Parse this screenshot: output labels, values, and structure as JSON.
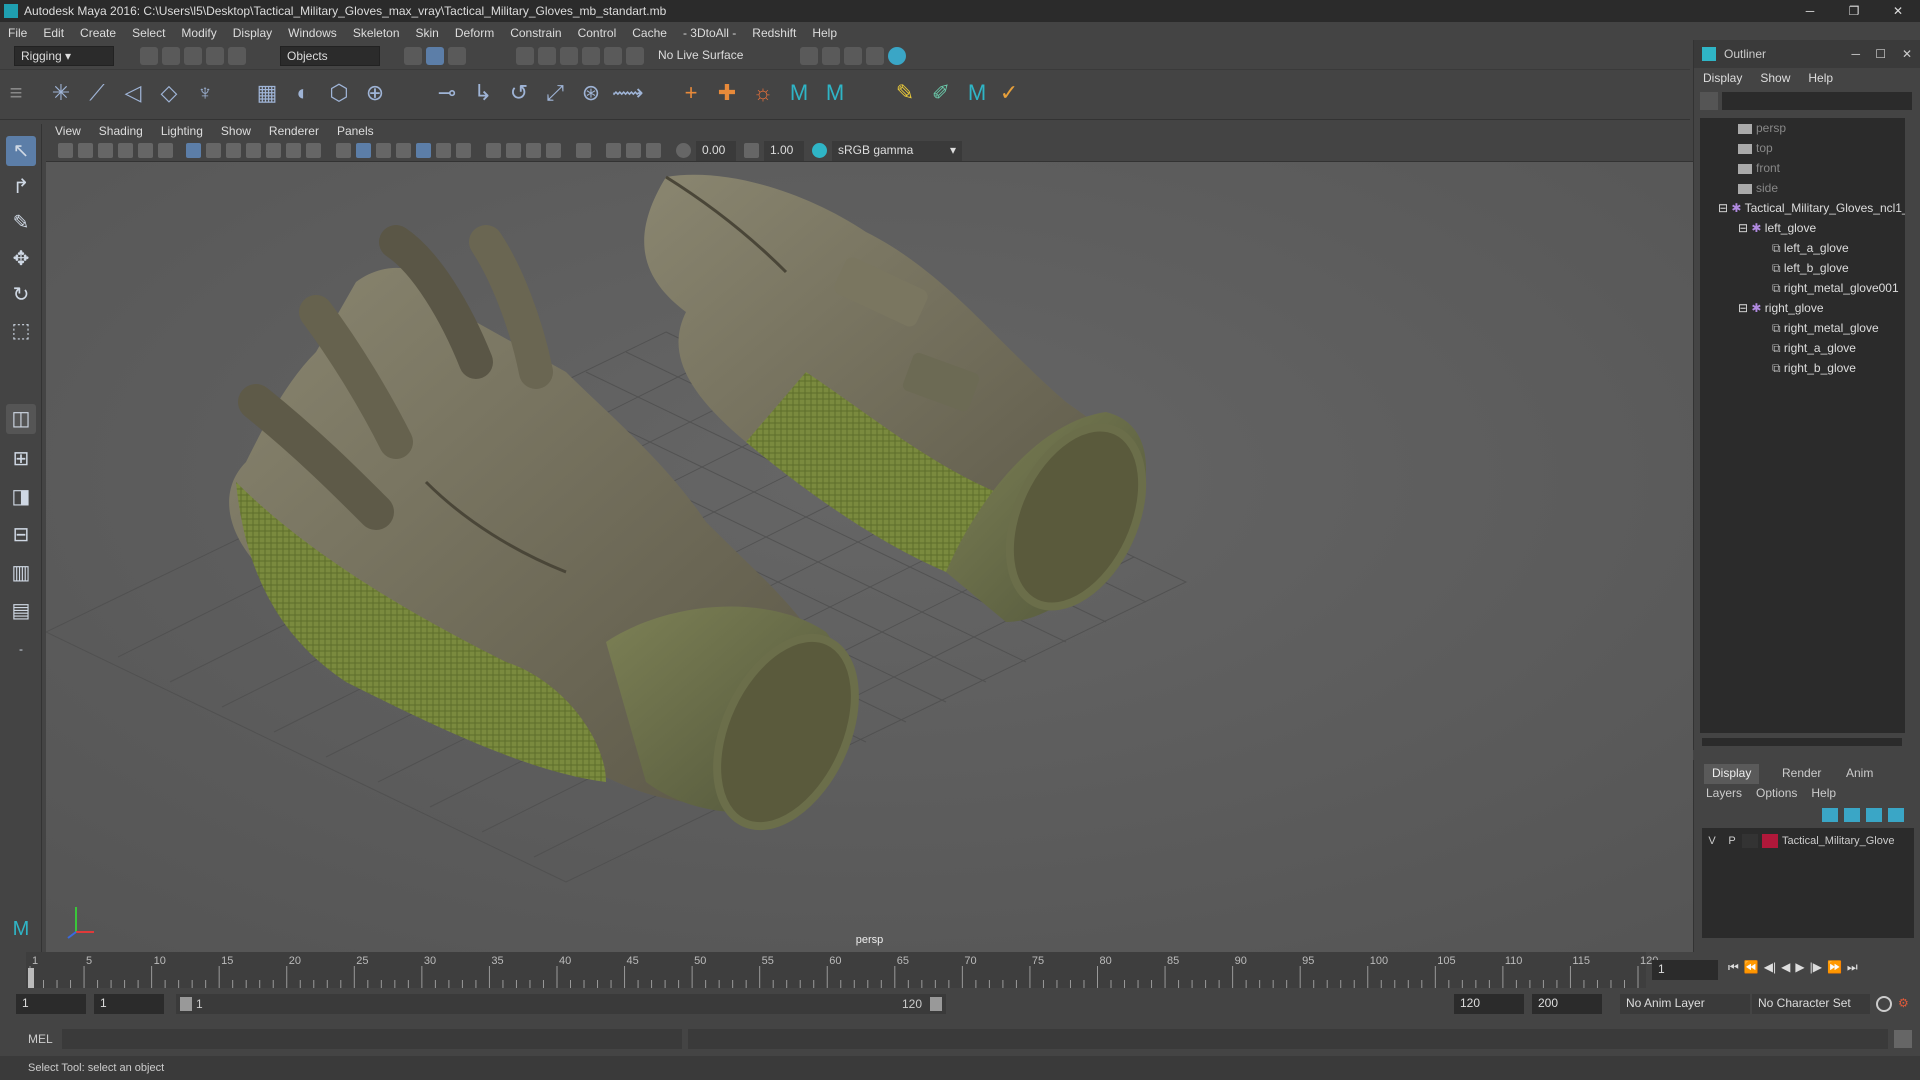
{
  "window": {
    "title": "Autodesk Maya 2016: C:\\Users\\l5\\Desktop\\Tactical_Military_Gloves_max_vray\\Tactical_Military_Gloves_mb_standart.mb",
    "controls": [
      "─",
      "❐",
      "✕"
    ]
  },
  "menubar": [
    "File",
    "Edit",
    "Create",
    "Select",
    "Modify",
    "Display",
    "Windows",
    "Skeleton",
    "Skin",
    "Deform",
    "Constrain",
    "Control",
    "Cache",
    "- 3DtoAll -",
    "Redshift",
    "Help"
  ],
  "shelf": {
    "mode": "Rigging",
    "select_mode": "Objects",
    "live_surface": "No Live Surface"
  },
  "viewport": {
    "menu": [
      "View",
      "Shading",
      "Lighting",
      "Show",
      "Renderer",
      "Panels"
    ],
    "exposure": "0.00",
    "gamma": "1.00",
    "color_space": "sRGB gamma",
    "camera_label": "persp"
  },
  "outliner": {
    "title": "Outliner",
    "menu": [
      "Display",
      "Show",
      "Help"
    ],
    "items": [
      {
        "label": "persp",
        "type": "camera"
      },
      {
        "label": "top",
        "type": "camera"
      },
      {
        "label": "front",
        "type": "camera"
      },
      {
        "label": "side",
        "type": "camera"
      },
      {
        "label": "Tactical_Military_Gloves_ncl1_",
        "type": "group"
      },
      {
        "label": "left_glove",
        "type": "group"
      },
      {
        "label": "left_a_glove",
        "type": "mesh"
      },
      {
        "label": "left_b_glove",
        "type": "mesh"
      },
      {
        "label": "right_metal_glove001",
        "type": "mesh"
      },
      {
        "label": "right_glove",
        "type": "group"
      },
      {
        "label": "right_metal_glove",
        "type": "mesh"
      },
      {
        "label": "right_a_glove",
        "type": "mesh"
      },
      {
        "label": "right_b_glove",
        "type": "mesh"
      }
    ]
  },
  "layer_editor": {
    "tabs": [
      "Display",
      "Render",
      "Anim"
    ],
    "menu": [
      "Layers",
      "Options",
      "Help"
    ],
    "layer": {
      "v": "V",
      "p": "P",
      "name": "Tactical_Military_Glove",
      "color": "#b0183a"
    }
  },
  "timeline": {
    "ticks": [
      "1",
      "5",
      "10",
      "15",
      "20",
      "25",
      "30",
      "35",
      "40",
      "45",
      "50",
      "55",
      "60",
      "65",
      "70",
      "75",
      "80",
      "85",
      "90",
      "95",
      "100",
      "105",
      "110",
      "115",
      "120"
    ],
    "current_frame": "1"
  },
  "range": {
    "start": "1",
    "start2": "1",
    "slider_start": "1",
    "slider_end": "120",
    "end": "120",
    "end2": "200",
    "anim_layer": "No Anim Layer",
    "char_set": "No Character Set"
  },
  "command": {
    "lang": "MEL"
  },
  "help_line": "Select Tool: select an object"
}
